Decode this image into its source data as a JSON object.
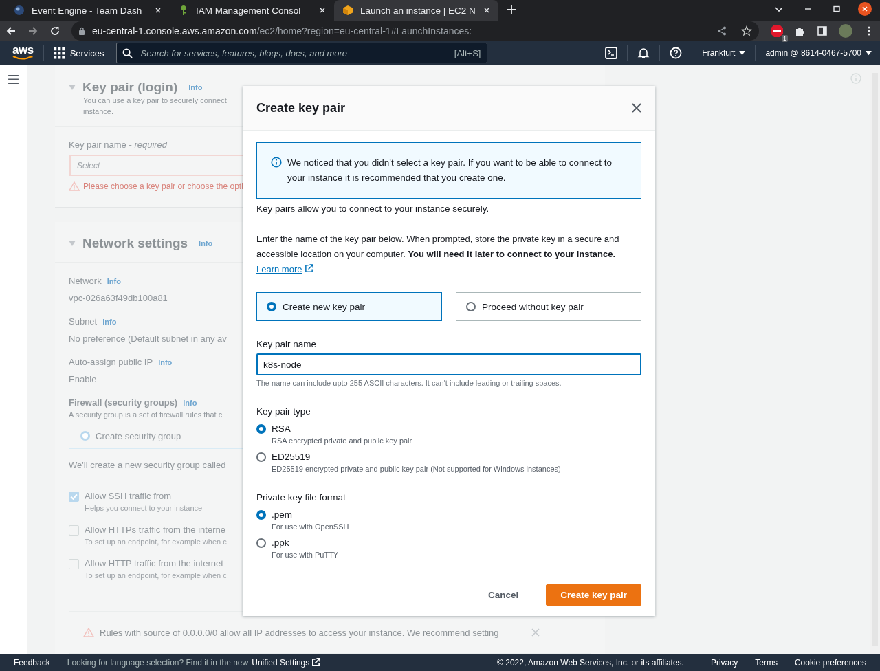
{
  "browser": {
    "tabs": [
      {
        "title": "Event Engine - Team Dash",
        "selected": false
      },
      {
        "title": "IAM Management Consol",
        "selected": false
      },
      {
        "title": "Launch an instance | EC2 N",
        "selected": true
      }
    ],
    "url_host": "eu-central-1.console.aws.amazon.com",
    "url_path": "/ec2/home?region=eu-central-1#LaunchInstances:",
    "extension_badge": "1"
  },
  "console_nav": {
    "logo": "aws",
    "services": "Services",
    "search_placeholder": "Search for services, features, blogs, docs, and more",
    "search_shortcut": "[Alt+S]",
    "region": "Frankfurt",
    "account": "admin @ 8614-0467-5700"
  },
  "background": {
    "key_pair_section": {
      "title": "Key pair (login)",
      "info": "Info",
      "description": [
        "You can use a key pair to securely connect",
        "instance."
      ],
      "field_label": "Key pair name - ",
      "field_required": "required",
      "select_placeholder": "Select",
      "error": "Please choose a key pair or choose the opti"
    },
    "network_section": {
      "title": "Network settings",
      "info": "Info",
      "fields": [
        {
          "label": "Network",
          "info": "Info",
          "value": "vpc-026a63f49db100a81"
        },
        {
          "label": "Subnet",
          "info": "Info",
          "value": "No preference (Default subnet in any av"
        },
        {
          "label": "Auto-assign public IP",
          "info": "Info",
          "value": "Enable"
        }
      ],
      "firewall_label": "Firewall (security groups)",
      "firewall_info": "Info",
      "firewall_description": "A security group is a set of firewall rules that c",
      "firewall_option": {
        "label": "Create security group",
        "selected": true
      },
      "note": "We'll create a new security group called",
      "rules": [
        {
          "label": "Allow SSH traffic from",
          "hint": "Helps you connect to your instance",
          "checked": true
        },
        {
          "label": "Allow HTTPs traffic from the interne",
          "hint": "To set up an endpoint, for example when c",
          "checked": false
        },
        {
          "label": "Allow HTTP traffic from the internet",
          "hint": "To set up an endpoint, for example when c",
          "checked": false
        }
      ],
      "warning": "Rules with source of 0.0.0.0/0 allow all IP addresses to access your instance. We recommend setting"
    }
  },
  "modal": {
    "title": "Create key pair",
    "alert": "We noticed that you didn't select a key pair. If you want to be able to connect to your instance it is recommended that you create one.",
    "intro": "Key pairs allow you to connect to your instance securely.",
    "paragraph": "Enter the name of the key pair below. When prompted, store the private key in a secure and accessible location on your computer. **You will need it later to connect to your instance.**",
    "learn_more": "Learn more",
    "choices": [
      {
        "label": "Create new key pair",
        "selected": true
      },
      {
        "label": "Proceed without key pair",
        "selected": false
      }
    ],
    "name_label": "Key pair name",
    "name_value": "k8s-node",
    "name_hint": "The name can include upto 255 ASCII characters. It can't include leading or trailing spaces.",
    "groups": [
      {
        "label": "Key pair type",
        "options": [
          {
            "label": "RSA",
            "description": "RSA encrypted private and public key pair",
            "selected": true
          },
          {
            "label": "ED25519",
            "description": "ED25519 encrypted private and public key pair (Not supported for Windows instances)",
            "selected": false
          }
        ]
      },
      {
        "label": "Private key file format",
        "options": [
          {
            "label": ".pem",
            "description": "For use with OpenSSH",
            "selected": true
          },
          {
            "label": ".ppk",
            "description": "For use with PuTTY",
            "selected": false
          }
        ]
      }
    ],
    "cancel": "Cancel",
    "submit": "Create key pair"
  },
  "footer": {
    "feedback": "Feedback",
    "language_note": "Looking for language selection? Find it in the new",
    "unified_settings": "Unified Settings",
    "copyright": "© 2022, Amazon Web Services, Inc. or its affiliates.",
    "links": [
      "Privacy",
      "Terms",
      "Cookie preferences"
    ]
  }
}
